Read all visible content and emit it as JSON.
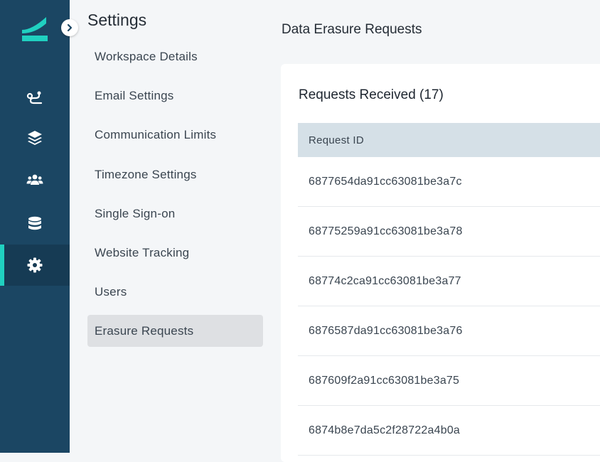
{
  "rail": {
    "items": [
      {
        "icon": "route-icon"
      },
      {
        "icon": "layers-icon"
      },
      {
        "icon": "users-icon"
      },
      {
        "icon": "database-icon"
      },
      {
        "icon": "gear-icon",
        "active": true
      }
    ],
    "accent": "#20d0c0",
    "background": "#1b4663"
  },
  "settings": {
    "title": "Settings",
    "nav": [
      {
        "label": "Workspace Details"
      },
      {
        "label": "Email Settings"
      },
      {
        "label": "Communication Limits"
      },
      {
        "label": "Timezone Settings"
      },
      {
        "label": "Single Sign-on"
      },
      {
        "label": "Website Tracking"
      },
      {
        "label": "Users"
      },
      {
        "label": "Erasure Requests",
        "active": true
      }
    ]
  },
  "main": {
    "title": "Data Erasure Requests",
    "card_title": "Requests Received (17)",
    "table": {
      "headers": [
        "Request ID"
      ],
      "rows": [
        "6877654da91cc63081be3a7c",
        "68775259a91cc63081be3a78",
        "68774c2ca91cc63081be3a77",
        "6876587da91cc63081be3a76",
        "687609f2a91cc63081be3a75",
        "6874b8e7da5c2f28722a4b0a"
      ]
    }
  }
}
